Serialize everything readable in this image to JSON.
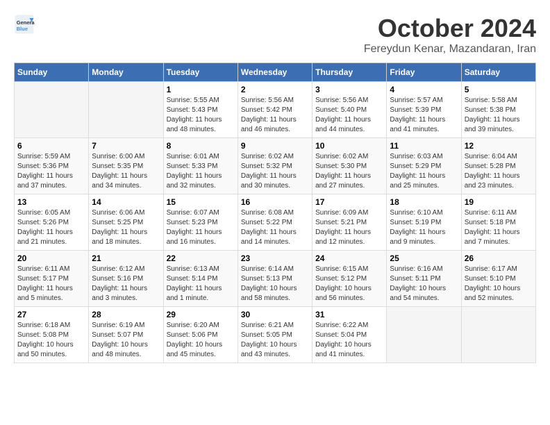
{
  "header": {
    "logo_general": "General",
    "logo_blue": "Blue",
    "month_title": "October 2024",
    "location": "Fereydun Kenar, Mazandaran, Iran"
  },
  "calendar": {
    "weekdays": [
      "Sunday",
      "Monday",
      "Tuesday",
      "Wednesday",
      "Thursday",
      "Friday",
      "Saturday"
    ],
    "rows": [
      [
        {
          "day": "",
          "sunrise": "",
          "sunset": "",
          "daylight": ""
        },
        {
          "day": "",
          "sunrise": "",
          "sunset": "",
          "daylight": ""
        },
        {
          "day": "1",
          "sunrise": "Sunrise: 5:55 AM",
          "sunset": "Sunset: 5:43 PM",
          "daylight": "Daylight: 11 hours and 48 minutes."
        },
        {
          "day": "2",
          "sunrise": "Sunrise: 5:56 AM",
          "sunset": "Sunset: 5:42 PM",
          "daylight": "Daylight: 11 hours and 46 minutes."
        },
        {
          "day": "3",
          "sunrise": "Sunrise: 5:56 AM",
          "sunset": "Sunset: 5:40 PM",
          "daylight": "Daylight: 11 hours and 44 minutes."
        },
        {
          "day": "4",
          "sunrise": "Sunrise: 5:57 AM",
          "sunset": "Sunset: 5:39 PM",
          "daylight": "Daylight: 11 hours and 41 minutes."
        },
        {
          "day": "5",
          "sunrise": "Sunrise: 5:58 AM",
          "sunset": "Sunset: 5:38 PM",
          "daylight": "Daylight: 11 hours and 39 minutes."
        }
      ],
      [
        {
          "day": "6",
          "sunrise": "Sunrise: 5:59 AM",
          "sunset": "Sunset: 5:36 PM",
          "daylight": "Daylight: 11 hours and 37 minutes."
        },
        {
          "day": "7",
          "sunrise": "Sunrise: 6:00 AM",
          "sunset": "Sunset: 5:35 PM",
          "daylight": "Daylight: 11 hours and 34 minutes."
        },
        {
          "day": "8",
          "sunrise": "Sunrise: 6:01 AM",
          "sunset": "Sunset: 5:33 PM",
          "daylight": "Daylight: 11 hours and 32 minutes."
        },
        {
          "day": "9",
          "sunrise": "Sunrise: 6:02 AM",
          "sunset": "Sunset: 5:32 PM",
          "daylight": "Daylight: 11 hours and 30 minutes."
        },
        {
          "day": "10",
          "sunrise": "Sunrise: 6:02 AM",
          "sunset": "Sunset: 5:30 PM",
          "daylight": "Daylight: 11 hours and 27 minutes."
        },
        {
          "day": "11",
          "sunrise": "Sunrise: 6:03 AM",
          "sunset": "Sunset: 5:29 PM",
          "daylight": "Daylight: 11 hours and 25 minutes."
        },
        {
          "day": "12",
          "sunrise": "Sunrise: 6:04 AM",
          "sunset": "Sunset: 5:28 PM",
          "daylight": "Daylight: 11 hours and 23 minutes."
        }
      ],
      [
        {
          "day": "13",
          "sunrise": "Sunrise: 6:05 AM",
          "sunset": "Sunset: 5:26 PM",
          "daylight": "Daylight: 11 hours and 21 minutes."
        },
        {
          "day": "14",
          "sunrise": "Sunrise: 6:06 AM",
          "sunset": "Sunset: 5:25 PM",
          "daylight": "Daylight: 11 hours and 18 minutes."
        },
        {
          "day": "15",
          "sunrise": "Sunrise: 6:07 AM",
          "sunset": "Sunset: 5:23 PM",
          "daylight": "Daylight: 11 hours and 16 minutes."
        },
        {
          "day": "16",
          "sunrise": "Sunrise: 6:08 AM",
          "sunset": "Sunset: 5:22 PM",
          "daylight": "Daylight: 11 hours and 14 minutes."
        },
        {
          "day": "17",
          "sunrise": "Sunrise: 6:09 AM",
          "sunset": "Sunset: 5:21 PM",
          "daylight": "Daylight: 11 hours and 12 minutes."
        },
        {
          "day": "18",
          "sunrise": "Sunrise: 6:10 AM",
          "sunset": "Sunset: 5:19 PM",
          "daylight": "Daylight: 11 hours and 9 minutes."
        },
        {
          "day": "19",
          "sunrise": "Sunrise: 6:11 AM",
          "sunset": "Sunset: 5:18 PM",
          "daylight": "Daylight: 11 hours and 7 minutes."
        }
      ],
      [
        {
          "day": "20",
          "sunrise": "Sunrise: 6:11 AM",
          "sunset": "Sunset: 5:17 PM",
          "daylight": "Daylight: 11 hours and 5 minutes."
        },
        {
          "day": "21",
          "sunrise": "Sunrise: 6:12 AM",
          "sunset": "Sunset: 5:16 PM",
          "daylight": "Daylight: 11 hours and 3 minutes."
        },
        {
          "day": "22",
          "sunrise": "Sunrise: 6:13 AM",
          "sunset": "Sunset: 5:14 PM",
          "daylight": "Daylight: 11 hours and 1 minute."
        },
        {
          "day": "23",
          "sunrise": "Sunrise: 6:14 AM",
          "sunset": "Sunset: 5:13 PM",
          "daylight": "Daylight: 10 hours and 58 minutes."
        },
        {
          "day": "24",
          "sunrise": "Sunrise: 6:15 AM",
          "sunset": "Sunset: 5:12 PM",
          "daylight": "Daylight: 10 hours and 56 minutes."
        },
        {
          "day": "25",
          "sunrise": "Sunrise: 6:16 AM",
          "sunset": "Sunset: 5:11 PM",
          "daylight": "Daylight: 10 hours and 54 minutes."
        },
        {
          "day": "26",
          "sunrise": "Sunrise: 6:17 AM",
          "sunset": "Sunset: 5:10 PM",
          "daylight": "Daylight: 10 hours and 52 minutes."
        }
      ],
      [
        {
          "day": "27",
          "sunrise": "Sunrise: 6:18 AM",
          "sunset": "Sunset: 5:08 PM",
          "daylight": "Daylight: 10 hours and 50 minutes."
        },
        {
          "day": "28",
          "sunrise": "Sunrise: 6:19 AM",
          "sunset": "Sunset: 5:07 PM",
          "daylight": "Daylight: 10 hours and 48 minutes."
        },
        {
          "day": "29",
          "sunrise": "Sunrise: 6:20 AM",
          "sunset": "Sunset: 5:06 PM",
          "daylight": "Daylight: 10 hours and 45 minutes."
        },
        {
          "day": "30",
          "sunrise": "Sunrise: 6:21 AM",
          "sunset": "Sunset: 5:05 PM",
          "daylight": "Daylight: 10 hours and 43 minutes."
        },
        {
          "day": "31",
          "sunrise": "Sunrise: 6:22 AM",
          "sunset": "Sunset: 5:04 PM",
          "daylight": "Daylight: 10 hours and 41 minutes."
        },
        {
          "day": "",
          "sunrise": "",
          "sunset": "",
          "daylight": ""
        },
        {
          "day": "",
          "sunrise": "",
          "sunset": "",
          "daylight": ""
        }
      ]
    ]
  }
}
